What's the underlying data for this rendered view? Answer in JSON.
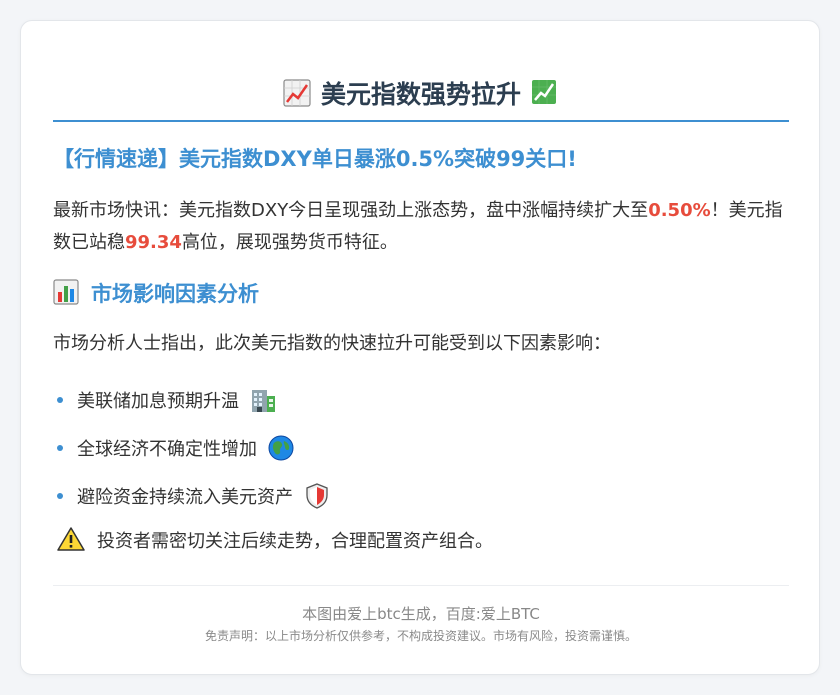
{
  "header": {
    "title": "美元指数强势拉升"
  },
  "headline": "【行情速递】美元指数DXY单日暴涨0.5%突破99关口!",
  "intro": {
    "part1": "最新市场快讯：美元指数DXY今日呈现强劲上涨态势，盘中涨幅持续扩大至",
    "gain": "0.50%",
    "part2": "！美元指数已站稳",
    "level": "99.34",
    "part3": "高位，展现强势货币特征。"
  },
  "analysis": {
    "heading": "市场影响因素分析",
    "lead": "市场分析人士指出，此次美元指数的快速拉升可能受到以下因素影响：",
    "factors": [
      {
        "label": "美联储加息预期升温",
        "icon": "bank-building-icon"
      },
      {
        "label": "全球经济不确定性增加",
        "icon": "globe-icon"
      },
      {
        "label": "避险资金持续流入美元资产",
        "icon": "shield-icon"
      }
    ]
  },
  "warning": {
    "icon": "warning-icon",
    "text": "投资者需密切关注后续走势，合理配置资产组合。"
  },
  "footer": {
    "credit": "本图由爱上btc生成，百度:爱上BTC",
    "disclaimer": "免责声明：以上市场分析仅供参考，不构成投资建议。市场有风险，投资需谨慎。"
  },
  "colors": {
    "accent": "#3d8fd1",
    "highlight": "#e74c3c",
    "title": "#2c3e50"
  }
}
